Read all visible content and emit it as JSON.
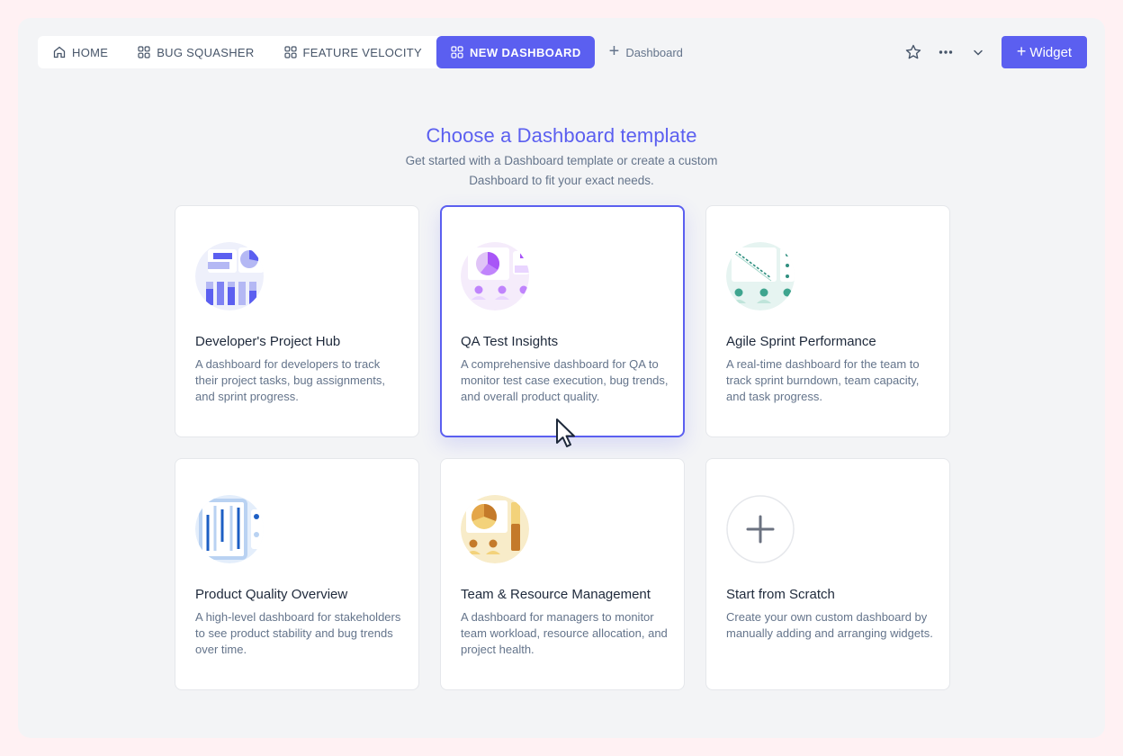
{
  "tabs": [
    {
      "label": "HOME",
      "icon": "home-icon",
      "active": false
    },
    {
      "label": "BUG SQUASHER",
      "icon": "grid-icon",
      "active": false
    },
    {
      "label": "FEATURE VELOCITY",
      "icon": "grid-icon",
      "active": false
    },
    {
      "label": "NEW DASHBOARD",
      "icon": "grid-icon",
      "active": true
    }
  ],
  "add_tab_label": "Dashboard",
  "toolbar": {
    "widget_label": "Widget",
    "icons": [
      "star-icon",
      "more-icon",
      "chevron-down-icon"
    ]
  },
  "heading": {
    "title": "Choose a Dashboard template",
    "subtitle_line1": "Get started with a Dashboard template or create a custom",
    "subtitle_line2": "Dashboard to fit your exact needs."
  },
  "templates": [
    {
      "title": "Developer's Project Hub",
      "desc": "A dashboard for developers to track their project tasks, bug assignments, and sprint progress.",
      "icon": "developer-hub-illustration"
    },
    {
      "title": "QA Test Insights",
      "desc": "A comprehensive dashboard for QA to monitor test case execution, bug trends, and overall product quality.",
      "icon": "qa-insights-illustration",
      "selected": true
    },
    {
      "title": "Agile Sprint Performance",
      "desc": "A real-time dashboard for the team to track sprint burndown, team capacity, and task progress.",
      "icon": "agile-sprint-illustration"
    },
    {
      "title": "Product Quality Overview",
      "desc": "A high-level dashboard for stakeholders to see product stability and bug trends over time.",
      "icon": "product-quality-illustration"
    },
    {
      "title": "Team & Resource Management",
      "desc": "A dashboard for managers to monitor team workload, resource allocation, and project health.",
      "icon": "team-resource-illustration"
    },
    {
      "title": "Start from Scratch",
      "desc": "Create your own custom dashboard by manually adding and arranging widgets.",
      "icon": "plus-icon"
    }
  ],
  "colors": {
    "accent": "#5b5ff0",
    "background": "#f3f4f6",
    "outer": "#fff1f3"
  }
}
